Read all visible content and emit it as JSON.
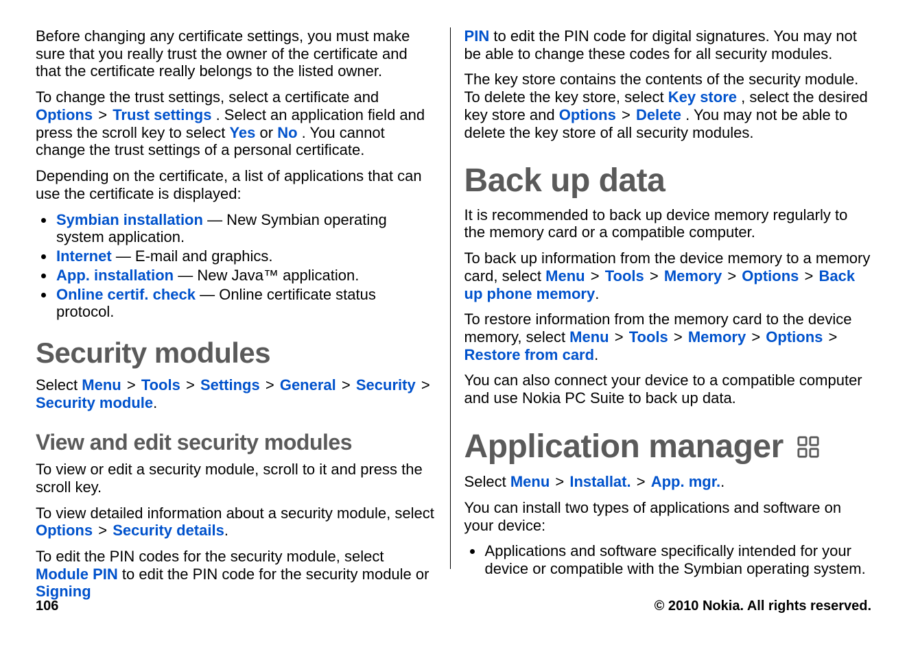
{
  "footer": {
    "page": "106",
    "copyright": "© 2010 Nokia. All rights reserved."
  },
  "left": {
    "p1": "Before changing any certificate settings, you must make sure that you really trust the owner of the certificate and that the certificate really belongs to the listed owner.",
    "p2a": "To change the trust settings, select a certificate and ",
    "options": "Options",
    "trust_settings": "Trust settings",
    "p2b": ". Select an application field and press the scroll key to select ",
    "yes": "Yes",
    "or": " or ",
    "no": "No",
    "p2c": ". You cannot change the trust settings of a personal certificate.",
    "p3": "Depending on the certificate, a list of applications that can use the certificate is displayed:",
    "li1_link": "Symbian installation",
    "li1_text": " — New Symbian operating system application.",
    "li2_link": "Internet",
    "li2_text": " — E-mail and graphics.",
    "li3_link": "App. installation",
    "li3_text": " — New Java™ application.",
    "li4_link": "Online certif. check",
    "li4_text": " — Online certificate status protocol.",
    "h_sec_modules": "Security modules",
    "sm_select": "Select ",
    "menu": "Menu",
    "tools": "Tools",
    "settings": "Settings",
    "general": "General",
    "security": "Security",
    "security_module": "Security module",
    "h_view_edit": "View and edit security modules",
    "ve_p1": "To view or edit a security module, scroll to it and press the scroll key.",
    "ve_p2a": "To view detailed information about a security module, select ",
    "security_details": "Security details",
    "ve_p3a": "To edit the PIN codes for the security module, select ",
    "module_pin": "Module PIN",
    "ve_p3b": " to edit the PIN code for the security module or ",
    "signing": "Signing"
  },
  "right": {
    "pin": "PIN",
    "p1b": " to edit the PIN code for digital signatures. You may not be able to change these codes for all security modules.",
    "p2a": "The key store contains the contents of the security module. To delete the key store, select ",
    "key_store": "Key store",
    "p2b": ", select the desired key store and ",
    "options": "Options",
    "delete": "Delete",
    "p2c": ". You may not be able to delete the key store of all security modules.",
    "h_backup": "Back up data",
    "bu_p1": "It is recommended to back up device memory regularly to the memory card or a compatible computer.",
    "bu_p2a": "To back up information from the device memory to a memory card, select ",
    "menu": "Menu",
    "tools": "Tools",
    "memory": "Memory",
    "options2": "Options",
    "back_up_phone_memory": "Back up phone memory",
    "bu_p3a": "To restore information from the memory card to the device memory, select ",
    "restore_from_card": "Restore from card",
    "bu_p4": "You can also connect your device to a compatible computer and use Nokia PC Suite to back up data.",
    "h_appmgr": "Application manager",
    "am_select": "Select ",
    "installat": "Installat.",
    "app_mgr": "App. mgr.",
    "am_p2": "You can install two types of applications and software on your device:",
    "am_li1": "Applications and software specifically intended for your device or compatible with the Symbian operating system."
  }
}
